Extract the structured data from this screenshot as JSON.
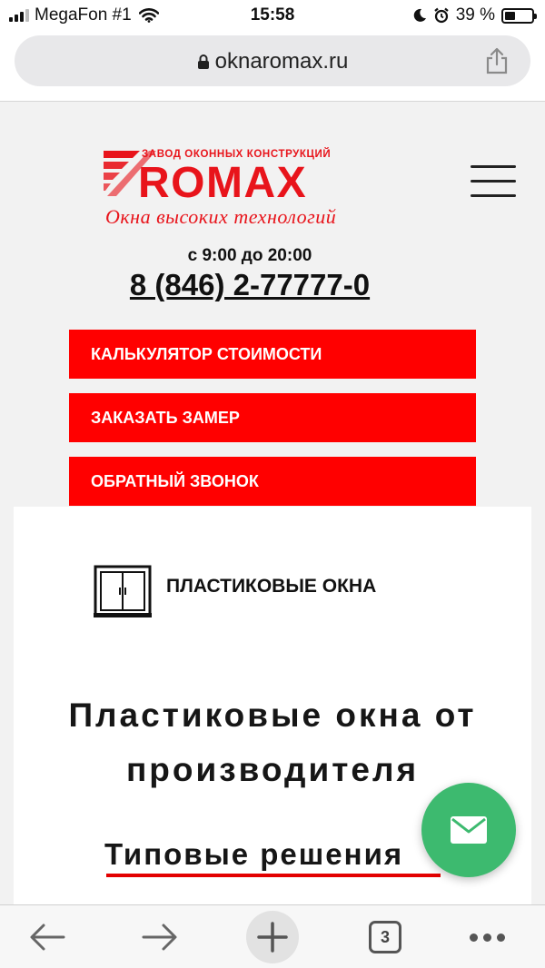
{
  "status_bar": {
    "carrier": "MegaFon #1",
    "time": "15:58",
    "battery_percent": "39 %",
    "battery_level": 0.39
  },
  "browser": {
    "url": "oknaromax.ru",
    "open_tabs": "3"
  },
  "header": {
    "logo_tagline_top": "ЗАВОД ОКОННЫХ КОНСТРУКЦИЙ",
    "logo_brand": "ROMAX",
    "logo_slogan": "Окна высоких технологий",
    "hours": "с 9:00 до 20:00",
    "phone": "8 (846) 2-77777-0"
  },
  "actions": {
    "calculator": "КАЛЬКУЛЯТОР СТОИМОСТИ",
    "order_measure": "ЗАКАЗАТЬ ЗАМЕР",
    "callback": "ОБРАТНЫЙ ЗВОНОК"
  },
  "content": {
    "category_label": "ПЛАСТИКОВЫЕ ОКНА",
    "heading_line1": "Пластиковые окна от",
    "heading_line2": "производителя",
    "subheading": "Типовые решения"
  },
  "colors": {
    "brand_red": "#ff0000",
    "fab_green": "#3dba6f"
  }
}
